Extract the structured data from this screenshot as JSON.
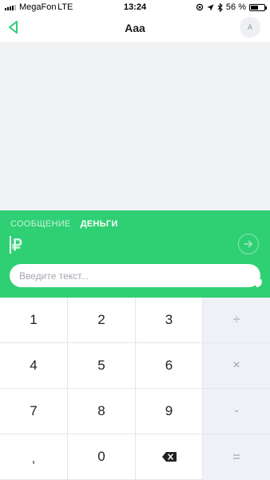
{
  "status_bar": {
    "carrier": "MegaFon",
    "network": "LTE",
    "time": "13:24",
    "battery": "56 %",
    "battery_level": 0.56
  },
  "nav": {
    "title": "Aaa",
    "avatar_letter": "A"
  },
  "composer": {
    "tabs": [
      {
        "label": "СООБЩЕНИЕ",
        "active": false
      },
      {
        "label": "ДЕНЬГИ",
        "active": true
      }
    ],
    "currency_symbol": "₽",
    "input_placeholder": "Введите текст..."
  },
  "keypad": {
    "keys": [
      {
        "label": "1",
        "op": false
      },
      {
        "label": "2",
        "op": false
      },
      {
        "label": "3",
        "op": false
      },
      {
        "label": "÷",
        "op": true
      },
      {
        "label": "4",
        "op": false
      },
      {
        "label": "5",
        "op": false
      },
      {
        "label": "6",
        "op": false
      },
      {
        "label": "×",
        "op": true
      },
      {
        "label": "7",
        "op": false
      },
      {
        "label": "8",
        "op": false
      },
      {
        "label": "9",
        "op": false
      },
      {
        "label": "-",
        "op": true
      },
      {
        "label": ",",
        "op": false
      },
      {
        "label": "0",
        "op": false
      },
      {
        "label": "",
        "icon": "backspace-icon",
        "op": false
      },
      {
        "label": "+",
        "op": true
      },
      {
        "label": "=",
        "op": true
      }
    ]
  },
  "colors": {
    "accent": "#2fcf74",
    "chat_background": "#f1f2f4",
    "operator_key_background": "#eef1f5"
  }
}
